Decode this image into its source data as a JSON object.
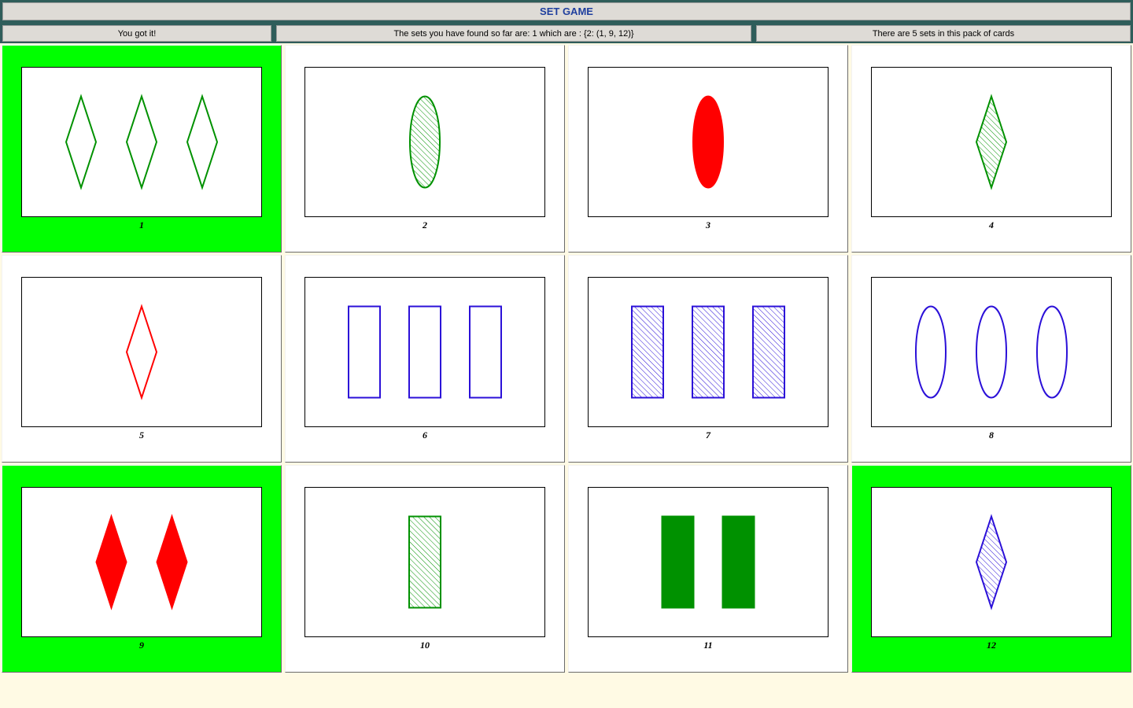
{
  "header": {
    "title": "SET GAME"
  },
  "status": {
    "message": "You got it!",
    "found_sets": "The sets you have found so far are: 1 which are : {2: (1, 9, 12)}",
    "total_sets": "There are 5 sets in this pack of cards"
  },
  "colors": {
    "green": "#009100",
    "red": "#ff0000",
    "purple": "#2b10d8",
    "selected": "#00ff00"
  },
  "cards": [
    {
      "number": "1",
      "count": 3,
      "shape": "diamond",
      "fill": "empty",
      "color": "green",
      "selected": true
    },
    {
      "number": "2",
      "count": 1,
      "shape": "oval",
      "fill": "striped",
      "color": "green",
      "selected": false
    },
    {
      "number": "3",
      "count": 1,
      "shape": "oval",
      "fill": "solid",
      "color": "red",
      "selected": false
    },
    {
      "number": "4",
      "count": 1,
      "shape": "diamond",
      "fill": "striped",
      "color": "green",
      "selected": false
    },
    {
      "number": "5",
      "count": 1,
      "shape": "diamond",
      "fill": "empty",
      "color": "red",
      "selected": false
    },
    {
      "number": "6",
      "count": 3,
      "shape": "rectangle",
      "fill": "empty",
      "color": "purple",
      "selected": false
    },
    {
      "number": "7",
      "count": 3,
      "shape": "rectangle",
      "fill": "striped",
      "color": "purple",
      "selected": false
    },
    {
      "number": "8",
      "count": 3,
      "shape": "oval",
      "fill": "empty",
      "color": "purple",
      "selected": false
    },
    {
      "number": "9",
      "count": 2,
      "shape": "diamond",
      "fill": "solid",
      "color": "red",
      "selected": true
    },
    {
      "number": "10",
      "count": 1,
      "shape": "rectangle",
      "fill": "striped",
      "color": "green",
      "selected": false
    },
    {
      "number": "11",
      "count": 2,
      "shape": "rectangle",
      "fill": "solid",
      "color": "green",
      "selected": false
    },
    {
      "number": "12",
      "count": 1,
      "shape": "diamond",
      "fill": "striped",
      "color": "purple",
      "selected": true
    }
  ]
}
